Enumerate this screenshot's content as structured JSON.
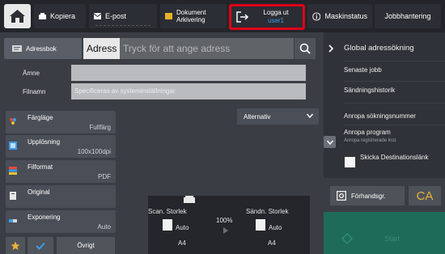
{
  "topbar": {
    "tabs": [
      {
        "label": "Kopiera",
        "icon": "copier-icon"
      },
      {
        "label": "E-post",
        "icon": "envelope-icon"
      },
      {
        "label_line1": "Dokument",
        "label_line2": "Arkivering",
        "icon": "folder-icon"
      }
    ],
    "logout": {
      "label": "Logga ut",
      "user": "user1",
      "icon": "logout-icon"
    },
    "machine_status": {
      "label": "Maskinstatus",
      "icon": "info-icon"
    },
    "job_status": {
      "label": "Jobbhantering"
    }
  },
  "address": {
    "address_book_label": "Adressbok",
    "address_label": "Adress",
    "address_placeholder": "Tryck för att ange adress"
  },
  "fields": {
    "subject_label": "Ämne",
    "subject_value": "",
    "filename_label": "Filnamn",
    "filename_placeholder": "Specificeras av systeminställningar"
  },
  "settings": [
    {
      "name": "Färgläge",
      "value": "Fullfärg",
      "icon": "color-mode-icon"
    },
    {
      "name": "Upplösning",
      "value": "100x100dpi",
      "icon": "resolution-icon"
    },
    {
      "name": "Filformat",
      "value": "PDF",
      "icon": "file-format-icon"
    },
    {
      "name": "Original",
      "value": "",
      "icon": "original-icon"
    },
    {
      "name": "Exponering",
      "value": "Auto",
      "icon": "exposure-icon"
    }
  ],
  "bottom_left": {
    "other_label": "Övrigt"
  },
  "alternativ": {
    "label": "Alternativ"
  },
  "preview": {
    "scan_size_label": "Scan. Storlek",
    "send_size_label": "Sändn. Storlek",
    "scan_size_value": "Auto",
    "send_size_value": "Auto",
    "scan_paper": "A4",
    "send_paper": "A4",
    "ratio": "100%"
  },
  "right_panel": {
    "global_search": "Global adressökning",
    "items": [
      "Senaste jobb",
      "Sändningshistorik",
      "Anropa sökningsnummer",
      "Anropa program"
    ],
    "program_sub": "Anropa registrerade inst.",
    "send_link": "Skicka Destinationslänk"
  },
  "actions": {
    "preview_label": "Förhandsgr.",
    "ca_label": "CA",
    "start_label": "Start"
  },
  "colors": {
    "logout_border": "#e0001b",
    "user_text": "#3c9cf2",
    "ca_text": "#e9b23a",
    "start_bg": "#1f6b59"
  }
}
